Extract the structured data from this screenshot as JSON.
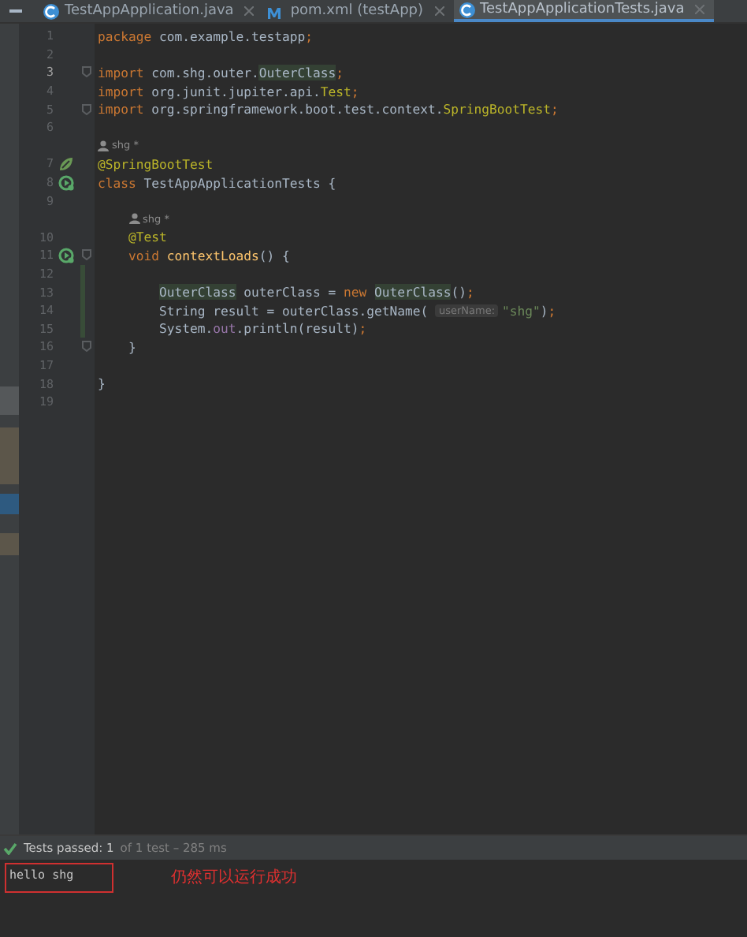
{
  "tabs": [
    {
      "label": "TestAppApplication.java",
      "kind": "class",
      "selected": false
    },
    {
      "label": "pom.xml (testApp)",
      "kind": "maven",
      "selected": false
    },
    {
      "label": "TestAppApplicationTests.java",
      "kind": "class",
      "selected": true
    }
  ],
  "code": [
    {
      "kind": "line",
      "number": "1",
      "tokens": [
        {
          "kind": "keyword",
          "text": "package"
        },
        {
          "kind": "plain",
          "text": " com.example.testapp"
        },
        {
          "kind": "keyword",
          "text": ";"
        }
      ]
    },
    {
      "kind": "line",
      "number": "2"
    },
    {
      "kind": "line",
      "number": "3",
      "current": true,
      "fold": true,
      "tokens": [
        {
          "kind": "keyword",
          "text": "import"
        },
        {
          "kind": "plain",
          "text": " com.shg.outer."
        },
        {
          "kind": "usage",
          "text": "OuterClass"
        },
        {
          "kind": "keyword",
          "text": ";"
        }
      ]
    },
    {
      "kind": "line",
      "number": "4",
      "tokens": [
        {
          "kind": "keyword",
          "text": "import"
        },
        {
          "kind": "plain",
          "text": " org.junit.jupiter.api."
        },
        {
          "kind": "annotation",
          "text": "Test"
        },
        {
          "kind": "keyword",
          "text": ";"
        }
      ]
    },
    {
      "kind": "line",
      "number": "5",
      "fold": true,
      "tokens": [
        {
          "kind": "keyword",
          "text": "import"
        },
        {
          "kind": "plain",
          "text": " org.springframework.boot.test.context."
        },
        {
          "kind": "annotation",
          "text": "SpringBootTest"
        },
        {
          "kind": "keyword",
          "text": ";"
        }
      ]
    },
    {
      "kind": "line",
      "number": "6"
    },
    {
      "kind": "author",
      "text": "shg *"
    },
    {
      "kind": "line",
      "number": "7",
      "bean": true,
      "tokens": [
        {
          "kind": "annotation",
          "text": "@SpringBootTest"
        }
      ]
    },
    {
      "kind": "line",
      "number": "8",
      "runnable": true,
      "tokens": [
        {
          "kind": "keyword",
          "text": "class"
        },
        {
          "kind": "plain",
          "text": " TestAppApplicationTests {"
        }
      ],
      "children": [
        {
          "kind": "line",
          "number": "9"
        },
        {
          "kind": "author",
          "text": "shg *"
        },
        {
          "kind": "line",
          "number": "10",
          "tokens": [
            {
              "kind": "annotation",
              "text": "@Test"
            }
          ]
        },
        {
          "kind": "line",
          "number": "11",
          "runnable": true,
          "fold": true,
          "tokens": [
            {
              "kind": "keyword",
              "text": "void"
            },
            {
              "kind": "method",
              "text": " contextLoads"
            },
            {
              "kind": "plain",
              "text": "() {"
            }
          ],
          "children": [
            {
              "kind": "line",
              "number": "12",
              "changed": true
            },
            {
              "kind": "line",
              "number": "13",
              "changed": true,
              "tokens": [
                {
                  "kind": "usage",
                  "text": "OuterClass"
                },
                {
                  "kind": "plain",
                  "text": " outerClass = "
                },
                {
                  "kind": "keyword",
                  "text": "new "
                },
                {
                  "kind": "usage",
                  "text": "OuterClass"
                },
                {
                  "kind": "plain",
                  "text": "()"
                },
                {
                  "kind": "keyword",
                  "text": ";"
                }
              ]
            },
            {
              "kind": "line",
              "number": "14",
              "changed": true,
              "tokens": [
                {
                  "kind": "plain",
                  "text": "String result = outerClass.getName( "
                },
                {
                  "kind": "hint",
                  "text": "userName:"
                },
                {
                  "kind": "string",
                  "text": "\"shg\""
                },
                {
                  "kind": "plain",
                  "text": ")"
                },
                {
                  "kind": "keyword",
                  "text": ";"
                }
              ]
            },
            {
              "kind": "line",
              "number": "15",
              "changed": true,
              "tokens": [
                {
                  "kind": "plain",
                  "text": "System."
                },
                {
                  "kind": "field",
                  "text": "out"
                },
                {
                  "kind": "plain",
                  "text": ".println(result)"
                },
                {
                  "kind": "keyword",
                  "text": ";"
                }
              ]
            }
          ]
        },
        {
          "kind": "line",
          "number": "16",
          "fold": true,
          "tokens": [
            {
              "kind": "plain",
              "text": "}"
            }
          ]
        },
        {
          "kind": "line",
          "number": "17"
        }
      ]
    },
    {
      "kind": "line",
      "number": "18",
      "tokens": [
        {
          "kind": "plain",
          "text": "}"
        }
      ]
    },
    {
      "kind": "line",
      "number": "19"
    }
  ],
  "test_status": {
    "passed": "Tests passed: 1",
    "detail": "of 1 test – 285 ms"
  },
  "console": {
    "output": "hello shg",
    "note": "仍然可以运行成功"
  }
}
